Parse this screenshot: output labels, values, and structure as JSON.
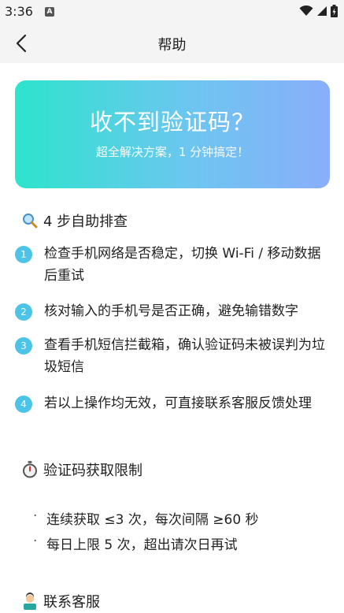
{
  "status_bar": {
    "time": "3:36",
    "app_icon_letter": "A",
    "icons": [
      "wifi-icon",
      "signal-icon",
      "battery-icon"
    ]
  },
  "header": {
    "title": "帮助",
    "back_icon": "chevron-left-icon"
  },
  "hero": {
    "title": "收不到验证码？",
    "subtitle": "超全解决方案，1 分钟搞定！",
    "gradient": [
      "#2de4cc",
      "#8aaefb"
    ]
  },
  "self_check": {
    "icon": "magnifier-icon",
    "heading": "4 步自助排查",
    "steps": [
      {
        "number": "1",
        "text": "检查手机网络是否稳定，切换 Wi-Fi / 移动数据后重试"
      },
      {
        "number": "2",
        "text": "核对输入的手机号是否正确，避免输错数字"
      },
      {
        "number": "3",
        "text": "查看手机短信拦截箱，确认验证码未被误判为垃圾短信"
      },
      {
        "number": "4",
        "text": "若以上操作均无效，可直接联系客服反馈处理"
      }
    ]
  },
  "limits": {
    "icon": "stopwatch-icon",
    "heading": "验证码获取限制",
    "items": [
      "连续获取 ≤3 次，每次间隔 ≥60 秒",
      "每日上限 5 次，超出请次日再试"
    ]
  },
  "contact": {
    "icon": "customer-service-icon",
    "heading": "联系客服"
  },
  "colors": {
    "step_badge": "#4ec3e8",
    "header_bg": "#f4f4f4"
  }
}
